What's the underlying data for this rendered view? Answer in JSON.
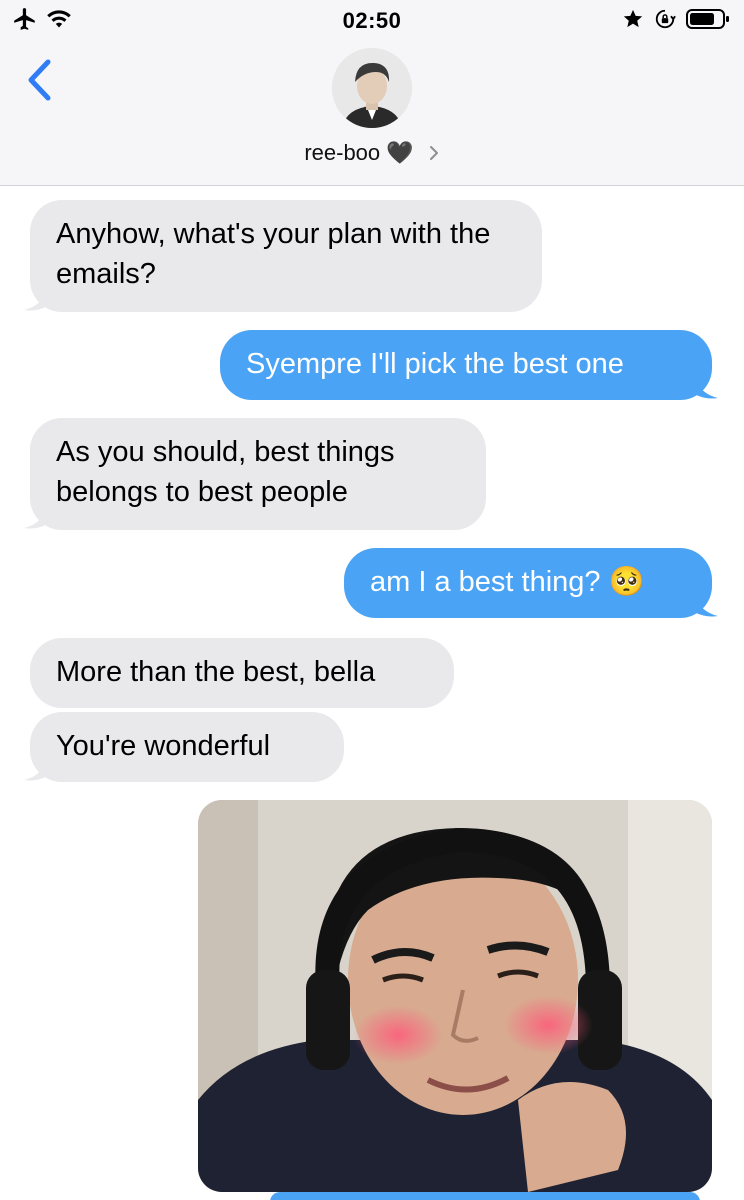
{
  "status_bar": {
    "time": "02:50",
    "left_icons": [
      "airplane-icon",
      "wifi-icon"
    ],
    "right_icons": [
      "star-icon",
      "orientation-lock-icon",
      "battery-icon"
    ]
  },
  "header": {
    "contact_name": "ree-boo 🖤",
    "back_icon": "chevron-left-icon",
    "details_icon": "chevron-right-icon"
  },
  "messages": [
    {
      "direction": "received",
      "text": "Anyhow, what's your plan with the emails?"
    },
    {
      "direction": "sent",
      "text": "Syempre I'll pick the best one"
    },
    {
      "direction": "received",
      "text": "As you should, best things belongs to best people"
    },
    {
      "direction": "sent",
      "text": "am I a best thing? 🥺"
    },
    {
      "direction": "received",
      "text": "More than the best, bella"
    },
    {
      "direction": "received",
      "text": "You're wonderful"
    },
    {
      "direction": "sent",
      "type": "image"
    }
  ],
  "colors": {
    "sent_bubble": "#4aa3f5",
    "received_bubble": "#e9e9eb",
    "accent": "#2f7cf6"
  }
}
